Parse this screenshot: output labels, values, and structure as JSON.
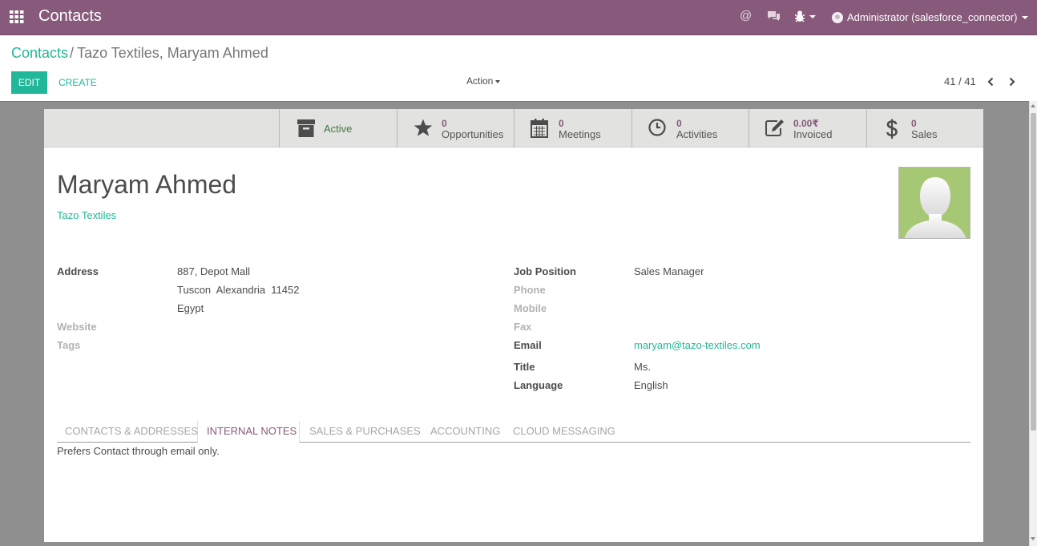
{
  "navbar": {
    "apps_icon": "apps-grid-icon",
    "title": "Contacts",
    "at_icon": "at-icon",
    "chat_icon": "chat-icon",
    "debug_icon": "bug-icon",
    "user_label": "Administrator (salesforce_connector)",
    "color": "#875a7b"
  },
  "breadcrumb": {
    "parent": "Contacts",
    "separator": "/",
    "current": "Tazo Textiles, Maryam Ahmed"
  },
  "toolbar": {
    "edit_label": "EDIT",
    "create_label": "CREATE",
    "action_label": "Action"
  },
  "pager": {
    "value": "41 / 41"
  },
  "stat_buttons": {
    "active": {
      "label": "Active",
      "icon": "archive-icon"
    },
    "opportunities": {
      "value": "0",
      "label": "Opportunities",
      "icon": "star-icon"
    },
    "meetings": {
      "value": "0",
      "label": "Meetings",
      "icon": "calendar-icon"
    },
    "activities": {
      "value": "0",
      "label": "Activities",
      "icon": "clock-icon"
    },
    "invoiced": {
      "value": "0.00₹",
      "label": "Invoiced",
      "icon": "edit-icon"
    },
    "sales": {
      "value": "0",
      "label": "Sales",
      "icon": "dollar-icon"
    }
  },
  "contact": {
    "name": "Maryam Ahmed",
    "company": "Tazo Textiles",
    "photo_icon": "avatar-placeholder-icon"
  },
  "fields_left": {
    "address_label": "Address",
    "address_line1": "887, Depot Mall",
    "address_line2": "Tuscon  Alexandria  11452",
    "address_line3": "Egypt",
    "website_label": "Website",
    "tags_label": "Tags"
  },
  "fields_right": {
    "job_position_label": "Job Position",
    "job_position_value": "Sales Manager",
    "phone_label": "Phone",
    "mobile_label": "Mobile",
    "fax_label": "Fax",
    "email_label": "Email",
    "email_value": "maryam@tazo-textiles.com",
    "title_label": "Title",
    "title_value": "Ms.",
    "language_label": "Language",
    "language_value": "English"
  },
  "tabs": [
    {
      "label": "CONTACTS & ADDRESSES"
    },
    {
      "label": "INTERNAL NOTES"
    },
    {
      "label": "SALES & PURCHASES"
    },
    {
      "label": "ACCOUNTING"
    },
    {
      "label": "CLOUD MESSAGING"
    }
  ],
  "active_tab": "INTERNAL NOTES",
  "internal_notes": "Prefers Contact through email only.",
  "colors": {
    "primary": "#875a7b",
    "accent": "#21b799"
  }
}
